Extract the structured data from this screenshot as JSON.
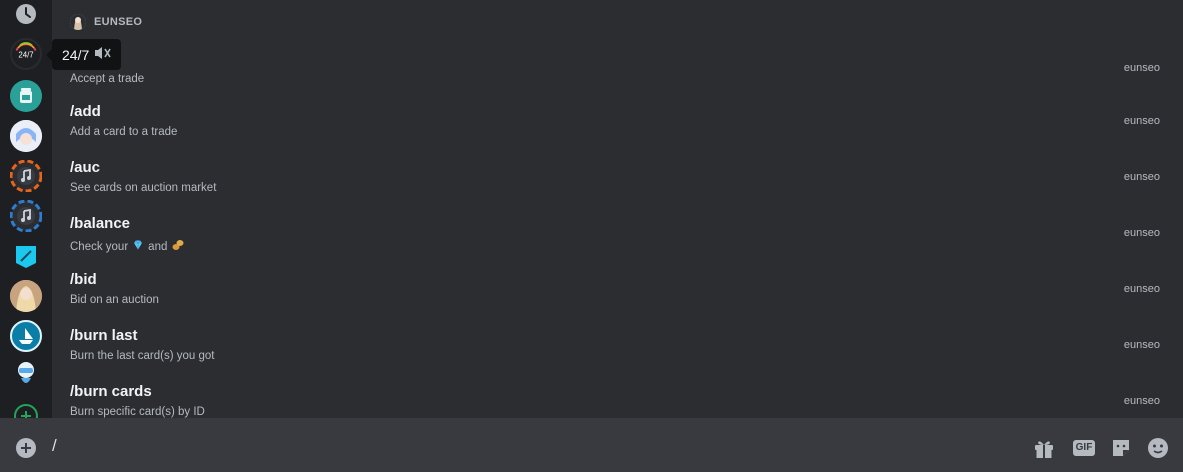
{
  "tooltip": {
    "label": "24/7",
    "icon": "speaker-muted-icon"
  },
  "rail": {
    "items": [
      {
        "name": "recent-icon",
        "color": "#b5bac1"
      },
      {
        "name": "server-24-7",
        "label": "24/7",
        "color": "#1e1f22"
      },
      {
        "name": "server-teal",
        "color": "#2aa198"
      },
      {
        "name": "server-anime-girl",
        "color": "#8ab4f8"
      },
      {
        "name": "server-music-orange",
        "color": "#e8641b"
      },
      {
        "name": "server-music-blue",
        "color": "#2d7dd2"
      },
      {
        "name": "server-cyan",
        "color": "#1cc8ee"
      },
      {
        "name": "server-blonde",
        "color": "#d9b99b"
      },
      {
        "name": "server-ship",
        "color": "#0b7ea8"
      },
      {
        "name": "server-robot",
        "color": "#5aa9e6"
      },
      {
        "name": "add-server-icon",
        "color": "#23a55a"
      }
    ]
  },
  "panel": {
    "header": "EUNSEO",
    "commands": [
      {
        "name": "",
        "description": "Accept a trade",
        "owner": "eunseo"
      },
      {
        "name": "/add",
        "description": "Add a card to a trade",
        "owner": "eunseo"
      },
      {
        "name": "/auc",
        "description": "See cards on auction market",
        "owner": "eunseo"
      },
      {
        "name": "/balance",
        "description": "Check your",
        "description_mid": "and",
        "owner": "eunseo"
      },
      {
        "name": "/bid",
        "description": "Bid on an auction",
        "owner": "eunseo"
      },
      {
        "name": "/burn last",
        "description": "Burn the last card(s) you got",
        "owner": "eunseo"
      },
      {
        "name": "/burn cards",
        "description": "Burn specific card(s) by ID",
        "owner": "eunseo"
      }
    ]
  },
  "input": {
    "value": "/"
  },
  "toolbar": {
    "gif_label": "GIF"
  },
  "colors": {
    "accent": "#23a55a",
    "text": "#f2f3f5",
    "muted": "#b5bac1"
  }
}
